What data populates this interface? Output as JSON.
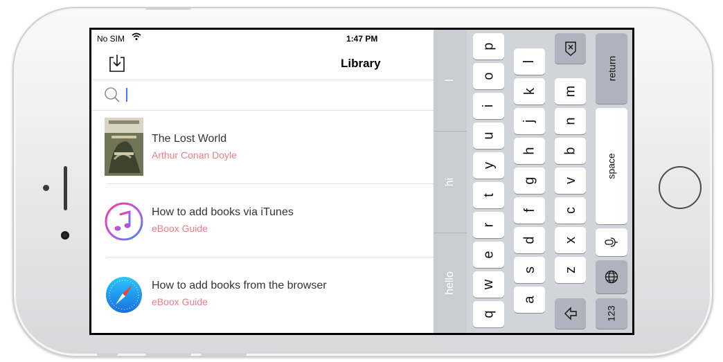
{
  "status_bar": {
    "carrier": "No SIM",
    "wifi_icon": "wifi-icon",
    "time": "1:47 PM"
  },
  "navbar": {
    "title": "Library",
    "import_icon": "import-icon"
  },
  "search": {
    "value": "",
    "placeholder": ""
  },
  "books": [
    {
      "title": "The Lost World",
      "author": "Arthur Conan Doyle",
      "cover": "book-cover"
    },
    {
      "title": "How to add books via iTunes",
      "author": "eBoox Guide",
      "cover": "itunes-icon"
    },
    {
      "title": "How to add books from the browser",
      "author": "eBoox Guide",
      "cover": "safari-icon"
    }
  ],
  "suggestions": [
    "l",
    "hi",
    "hello"
  ],
  "keyboard": {
    "row1": [
      "q",
      "w",
      "e",
      "r",
      "t",
      "y",
      "u",
      "i",
      "o",
      "p"
    ],
    "row2": [
      "a",
      "s",
      "d",
      "f",
      "g",
      "h",
      "j",
      "k",
      "l"
    ],
    "row3": [
      "z",
      "x",
      "c",
      "v",
      "b",
      "n",
      "m"
    ],
    "shift_icon": "shift-icon",
    "delete_icon": "delete-icon",
    "numbers_label": "123",
    "globe_icon": "globe-icon",
    "mic_icon": "microphone-icon",
    "space_label": "space",
    "return_label": "return"
  },
  "colors": {
    "author": "#f07b87",
    "caret": "#3b82f6",
    "keyboard_bg": "#d1d4d9",
    "suggestion_bg": "#c9ccd2"
  }
}
